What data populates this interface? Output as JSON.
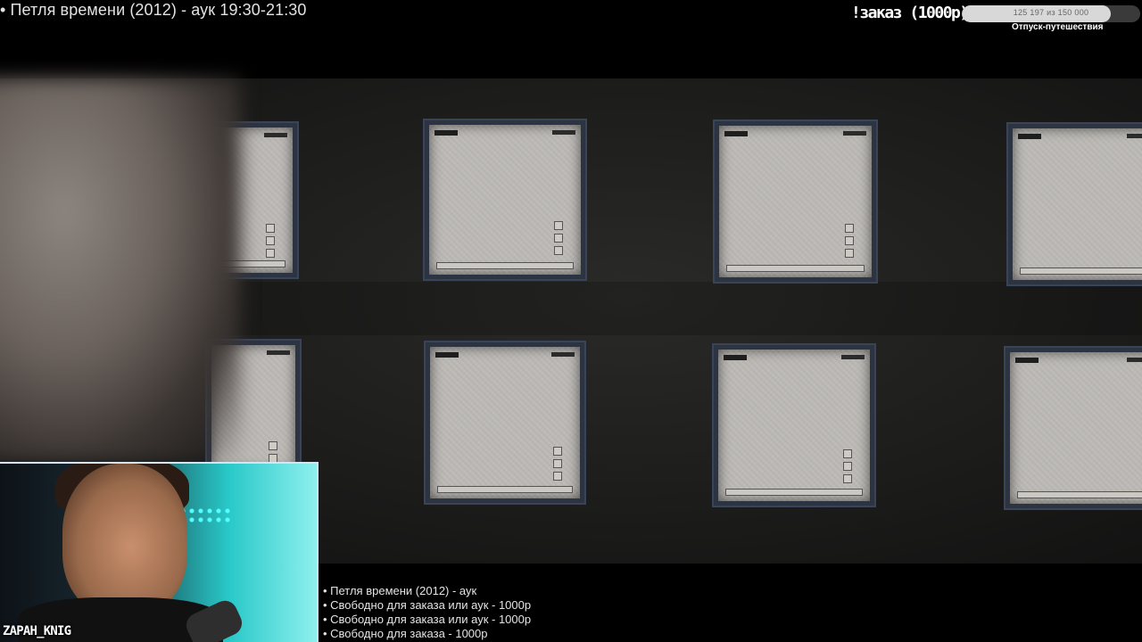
{
  "stream": {
    "now_playing": "• Петля времени (2012) - аук 19:30-21:30",
    "goal": {
      "label": "!заказ (1000р)",
      "progress_text": "125 197 из 150 000",
      "current": 125197,
      "target": 150000,
      "caption": "Отпуск-путешествия"
    },
    "webcam_name": "ZAPAH_KNIG",
    "queue": [
      "• Петля времени (2012) - аук",
      "• Свободно для заказа или аук - 1000р",
      "• Свободно для заказа или аук - 1000р",
      "• Свободно для заказа - 1000р"
    ]
  },
  "colors": {
    "background": "#000000",
    "panel": "#bdbab6",
    "panel_border": "#2c3341",
    "goal_fill": "#d8d8d8",
    "webcam_glow": "#28c8c8"
  }
}
